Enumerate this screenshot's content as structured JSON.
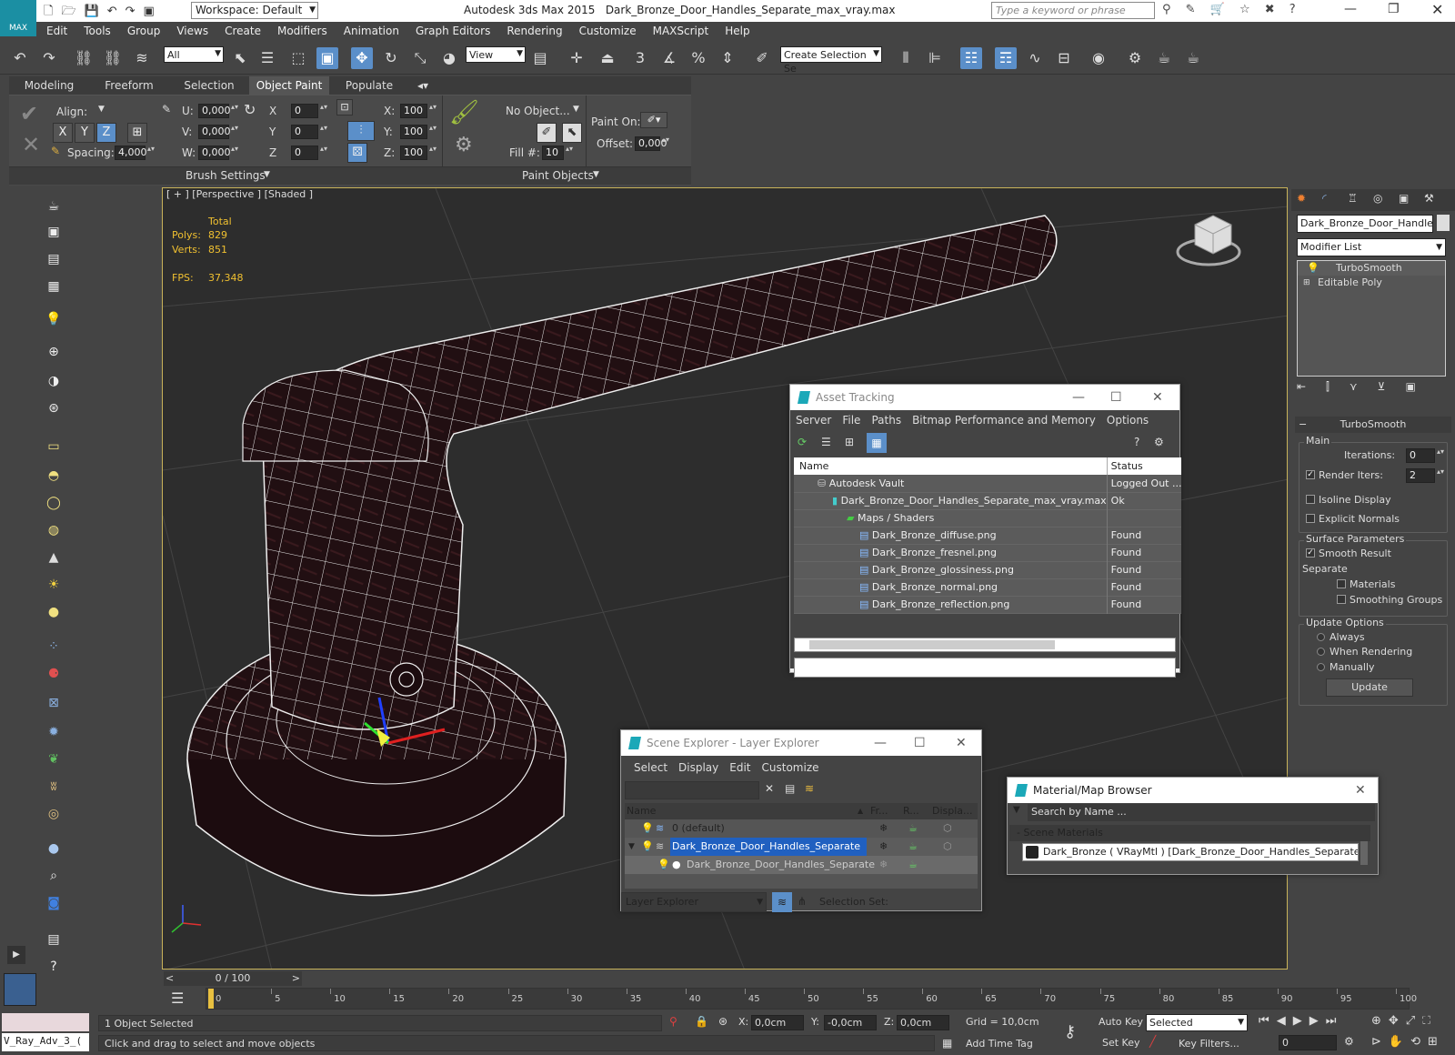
{
  "title": {
    "app": "Autodesk 3ds Max  2015",
    "file": "Dark_Bronze_Door_Handles_Separate_max_vray.max",
    "workspace": "Workspace: Default",
    "search_placeholder": "Type a keyword or phrase",
    "logo": "MAX"
  },
  "menu": [
    "Edit",
    "Tools",
    "Group",
    "Views",
    "Create",
    "Modifiers",
    "Animation",
    "Graph Editors",
    "Rendering",
    "Customize",
    "MAXScript",
    "Help"
  ],
  "toolbar": {
    "filter": "All",
    "refcoord": "View",
    "selset": "Create Selection Se",
    "snap3": "3",
    "snappct": "%"
  },
  "ribbon_tabs": [
    "Modeling",
    "Freeform",
    "Selection",
    "Object Paint",
    "Populate"
  ],
  "ribbon": {
    "align": "Align:",
    "spacing_label": "Spacing:",
    "spacing": "4,000",
    "u": "U:",
    "v": "V:",
    "w": "W:",
    "u_val": "0,000",
    "v_val": "0,000",
    "w_val": "0,000",
    "x": "X",
    "y": "Y",
    "z": "Z",
    "x_val": "0",
    "y_val": "0",
    "z_val": "0",
    "xs": "X:",
    "ys": "Y:",
    "zs": "Z:",
    "xs_val": "100",
    "ys_val": "100",
    "zs_val": "100",
    "no_object": "No Object...",
    "fill": "Fill #:",
    "fill_val": "10",
    "paint_on": "Paint On:",
    "offset": "Offset:",
    "offset_val": "0,000",
    "brush_settings": "Brush Settings",
    "paint_objects": "Paint Objects"
  },
  "viewport": {
    "label": "[ + ] [Perspective ] [Shaded ]",
    "total": "Total",
    "polys_label": "Polys:",
    "polys": "829",
    "verts_label": "Verts:",
    "verts": "851",
    "fps_label": "FPS:",
    "fps": "37,348"
  },
  "asset_tracking": {
    "title": "Asset Tracking",
    "menu": [
      "Server",
      "File",
      "Paths",
      "Bitmap Performance and Memory",
      "Options"
    ],
    "col_name": "Name",
    "col_status": "Status",
    "rows": [
      {
        "name": "Autodesk Vault",
        "status": "Logged Out ...",
        "indent": 1
      },
      {
        "name": "Dark_Bronze_Door_Handles_Separate_max_vray.max",
        "status": "Ok",
        "indent": 2
      },
      {
        "name": "Maps / Shaders",
        "status": "",
        "indent": 3
      },
      {
        "name": "Dark_Bronze_diffuse.png",
        "status": "Found",
        "indent": 4
      },
      {
        "name": "Dark_Bronze_fresnel.png",
        "status": "Found",
        "indent": 4
      },
      {
        "name": "Dark_Bronze_glossiness.png",
        "status": "Found",
        "indent": 4
      },
      {
        "name": "Dark_Bronze_normal.png",
        "status": "Found",
        "indent": 4
      },
      {
        "name": "Dark_Bronze_reflection.png",
        "status": "Found",
        "indent": 4
      }
    ]
  },
  "scene_explorer": {
    "title": "Scene Explorer - Layer Explorer",
    "menu": [
      "Select",
      "Display",
      "Edit",
      "Customize"
    ],
    "col_name": "Name",
    "col_fr": "Fr...",
    "col_r": "R...",
    "col_disp": "Displa...",
    "rows": [
      {
        "name": "0 (default)"
      },
      {
        "name": "Dark_Bronze_Door_Handles_Separate"
      },
      {
        "name": "Dark_Bronze_Door_Handles_Separate"
      }
    ],
    "footer_combo": "Layer Explorer",
    "selection_set": "Selection Set:"
  },
  "material_browser": {
    "title": "Material/Map Browser",
    "search": "Search by Name ...",
    "section": "- Scene Materials",
    "item": "Dark_Bronze  ( VRayMtl ) [Dark_Bronze_Door_Handles_Separate]"
  },
  "command_panel": {
    "object_name": "Dark_Bronze_Door_Handles_",
    "modifier_list": "Modifier List",
    "stack": [
      "TurboSmooth",
      "Editable Poly"
    ],
    "rollout": "TurboSmooth",
    "main": "Main",
    "iterations": "Iterations:",
    "iterations_val": "0",
    "render_iters": "Render Iters:",
    "render_iters_val": "2",
    "isoline": "Isoline Display",
    "explicit": "Explicit Normals",
    "surface": "Surface Parameters",
    "smooth_result": "Smooth Result",
    "separate": "Separate",
    "materials": "Materials",
    "smoothing_groups": "Smoothing Groups",
    "update_options": "Update Options",
    "always": "Always",
    "when_rendering": "When Rendering",
    "manually": "Manually",
    "update_btn": "Update"
  },
  "timeline": {
    "frame": "0 / 100",
    "ticks": [
      "0",
      "5",
      "10",
      "15",
      "20",
      "25",
      "30",
      "35",
      "40",
      "45",
      "50",
      "55",
      "60",
      "65",
      "70",
      "75",
      "80",
      "85",
      "90",
      "95",
      "100"
    ]
  },
  "status": {
    "maxscript": "V_Ray_Adv_3_(",
    "selected": "1 Object Selected",
    "hint": "Click and drag to select and move objects",
    "x": "X:",
    "y": "Y:",
    "z": "Z:",
    "x_val": "0,0cm",
    "y_val": "-0,0cm",
    "z_val": "0,0cm",
    "grid": "Grid = 10,0cm",
    "auto_key": "Auto Key",
    "set_key": "Set Key",
    "selected_combo": "Selected",
    "key_filters": "Key Filters...",
    "add_time_tag": "Add Time Tag",
    "frame_val": "0"
  }
}
